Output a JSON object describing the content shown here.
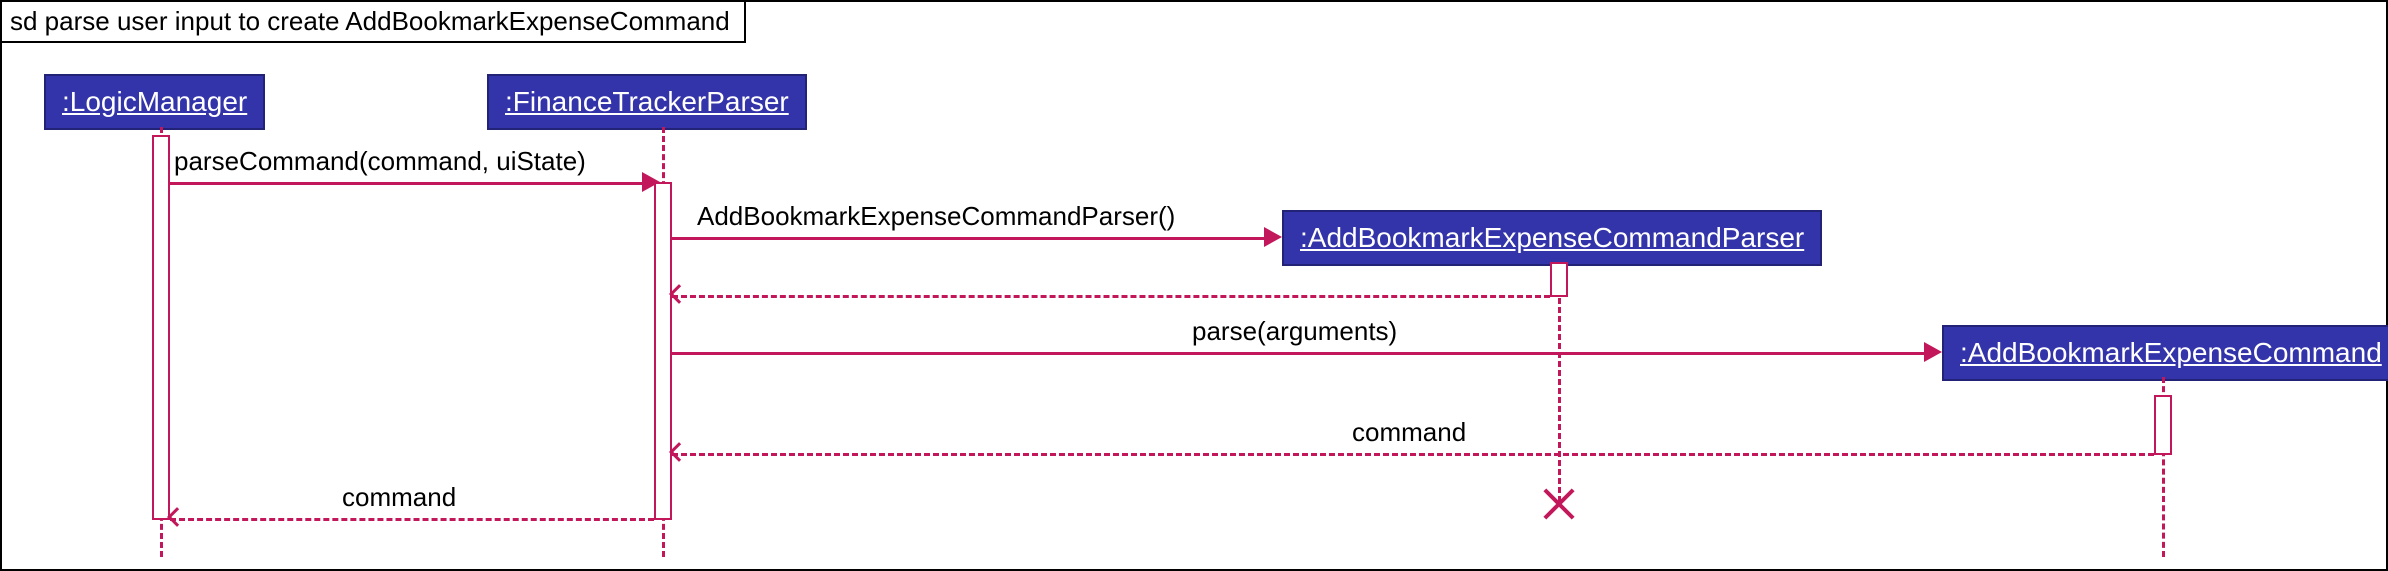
{
  "frame": {
    "label": "sd parse user input to create AddBookmarkExpenseCommand"
  },
  "participants": {
    "p1": ":LogicManager",
    "p2": ":FinanceTrackerParser",
    "p3": ":AddBookmarkExpenseCommandParser",
    "p4": ":AddBookmarkExpenseCommand"
  },
  "messages": {
    "m1": "parseCommand(command, uiState)",
    "m2": "AddBookmarkExpenseCommandParser()",
    "m3": "parse(arguments)",
    "m4": "command",
    "m5": "command"
  },
  "chart_data": {
    "type": "sequence_diagram",
    "title": "sd parse user input to create AddBookmarkExpenseCommand",
    "participants": [
      {
        "id": "LogicManager",
        "label": ":LogicManager"
      },
      {
        "id": "FinanceTrackerParser",
        "label": ":FinanceTrackerParser"
      },
      {
        "id": "AddBookmarkExpenseCommandParser",
        "label": ":AddBookmarkExpenseCommandParser",
        "destroyed": true
      },
      {
        "id": "AddBookmarkExpenseCommand",
        "label": ":AddBookmarkExpenseCommand"
      }
    ],
    "messages": [
      {
        "from": "LogicManager",
        "to": "FinanceTrackerParser",
        "label": "parseCommand(command, uiState)",
        "type": "sync"
      },
      {
        "from": "FinanceTrackerParser",
        "to": "AddBookmarkExpenseCommandParser",
        "label": "AddBookmarkExpenseCommandParser()",
        "type": "create"
      },
      {
        "from": "AddBookmarkExpenseCommandParser",
        "to": "FinanceTrackerParser",
        "label": "",
        "type": "return"
      },
      {
        "from": "FinanceTrackerParser",
        "to": "AddBookmarkExpenseCommand",
        "label": "parse(arguments)",
        "type": "sync"
      },
      {
        "from": "AddBookmarkExpenseCommand",
        "to": "FinanceTrackerParser",
        "label": "command",
        "type": "return"
      },
      {
        "from": "FinanceTrackerParser",
        "to": "LogicManager",
        "label": "command",
        "type": "return"
      }
    ]
  }
}
